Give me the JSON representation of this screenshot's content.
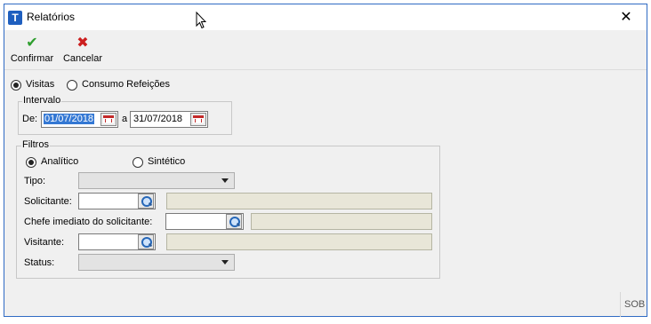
{
  "window": {
    "title": "Relatórios",
    "close_glyph": "✕",
    "accent": "#2f6bc4"
  },
  "toolbar": {
    "confirm_label": "Confirmar",
    "confirm_icon": "check-icon",
    "cancel_label": "Cancelar",
    "cancel_icon": "x-icon"
  },
  "report_type": {
    "options": [
      {
        "label": "Visitas",
        "checked": true
      },
      {
        "label": "Consumo Refeições",
        "checked": false
      }
    ]
  },
  "interval": {
    "legend": "Intervalo",
    "from_label": "De:",
    "from_value": "01/07/2018",
    "to_label": "a",
    "to_value": "31/07/2018"
  },
  "filters": {
    "legend": "Filtros",
    "mode_options": [
      {
        "label": "Analítico",
        "checked": true
      },
      {
        "label": "Sintético",
        "checked": false
      }
    ],
    "tipo_label": "Tipo:",
    "tipo_value": "",
    "solicitante_label": "Solicitante:",
    "chefe_label": "Chefe imediato do solicitante:",
    "visitante_label": "Visitante:",
    "status_label": "Status:",
    "status_value": ""
  },
  "statusbar": {
    "right_text": "SOB"
  }
}
